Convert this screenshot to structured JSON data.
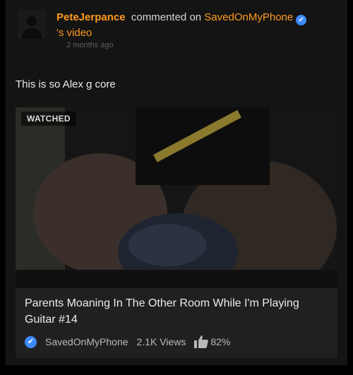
{
  "activity": {
    "username": "PeteJerpance",
    "action_text": "commented on",
    "channel": "SavedOnMyPhone",
    "possessive_video": "'s video",
    "time_ago": "2 months ago"
  },
  "comment": {
    "text": "This is so Alex g core"
  },
  "video": {
    "badge": "WATCHED",
    "title": "Parents Moaning In The Other Room While I'm Playing Guitar #14",
    "channel": "SavedOnMyPhone",
    "views": "2.1K Views",
    "rating": "82%"
  },
  "icons": {
    "verified": "verified-check-icon",
    "thumbs_up": "thumbs-up-icon",
    "avatar": "default-avatar-icon"
  },
  "colors": {
    "username": "#ff9a1f",
    "verified": "#3d8bff",
    "background": "#141414",
    "card": "#202020"
  }
}
